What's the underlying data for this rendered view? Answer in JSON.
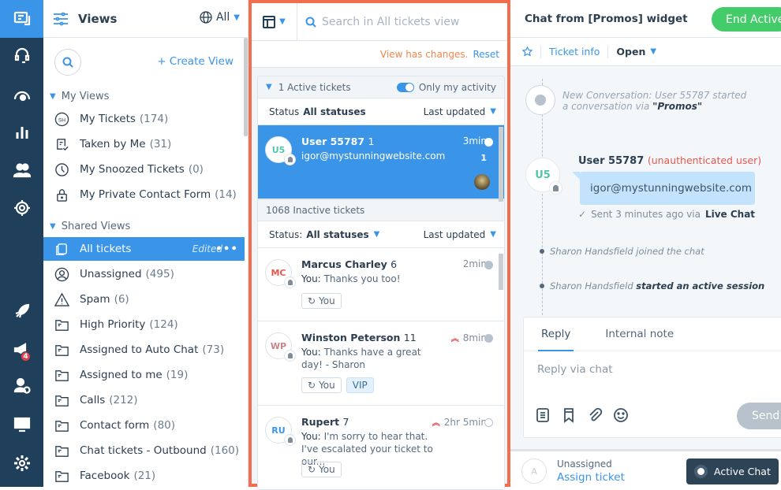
{
  "rail": {
    "items": [
      {
        "icon": "conversations-icon",
        "active": true
      },
      {
        "icon": "headset-icon"
      },
      {
        "icon": "dashboard-gauge-icon"
      },
      {
        "icon": "reports-bar-icon"
      },
      {
        "icon": "contacts-icon"
      },
      {
        "icon": "target-icon"
      },
      {
        "icon": "rocket-icon"
      },
      {
        "icon": "megaphone-icon",
        "badge": "4"
      },
      {
        "icon": "add-user-icon"
      },
      {
        "icon": "monitor-icon"
      },
      {
        "icon": "settings-gear-icon"
      }
    ]
  },
  "views": {
    "title": "Views",
    "filter_label": "All",
    "create_view": "+ Create View",
    "sections": {
      "my_views": "My Views",
      "shared_views": "Shared Views"
    },
    "my_views": [
      {
        "label": "My Tickets",
        "count": "(174)",
        "icon": "initials-sh-icon"
      },
      {
        "label": "Taken by Me",
        "count": "(31)",
        "icon": "ticket-check-icon"
      },
      {
        "label": "My Snoozed Tickets",
        "count": "(0)",
        "icon": "clock-icon"
      },
      {
        "label": "My Private Contact Form",
        "count": "(14)",
        "icon": "lock-icon"
      }
    ],
    "shared_views": [
      {
        "label": "All tickets",
        "count": "",
        "icon": "all-tickets-icon",
        "selected": true,
        "edited": "Edited",
        "more": "•••"
      },
      {
        "label": "Unassigned",
        "count": "(495)",
        "icon": "user-circle-icon"
      },
      {
        "label": "Spam",
        "count": "(6)",
        "icon": "warning-icon"
      },
      {
        "label": "High Priority",
        "count": "(124)",
        "icon": "folder-icon"
      },
      {
        "label": "Assigned to Auto Chat",
        "count": "(73)",
        "icon": "folder-icon"
      },
      {
        "label": "Assigned to me",
        "count": "(19)",
        "icon": "folder-icon"
      },
      {
        "label": "Calls",
        "count": "(212)",
        "icon": "folder-icon"
      },
      {
        "label": "Contact form",
        "count": "(80)",
        "icon": "folder-icon"
      },
      {
        "label": "Chat tickets - Outbound",
        "count": "(160)",
        "icon": "folder-icon"
      },
      {
        "label": "Facebook",
        "count": "(21)",
        "icon": "folder-icon"
      }
    ]
  },
  "list": {
    "search_placeholder": "Search in All tickets view",
    "changes_msg": "View has changes.",
    "reset": "Reset",
    "active_group": {
      "title": "1 Active tickets",
      "toggle_label": "Only my activity",
      "toggle_on": true,
      "status_label": "Status",
      "status_value": "All statuses",
      "sort": "Last updated"
    },
    "inactive_group": {
      "title": "1068 Inactive tickets",
      "status_label": "Status:",
      "status_value": "All statuses",
      "sort": "Last updated"
    },
    "active_tickets": [
      {
        "initials": "U5",
        "name": "User 55787",
        "count": "1",
        "message": "igor@mystunningwebsite.com",
        "time": "3min",
        "unread": "1",
        "color": "#4fc8a8"
      }
    ],
    "tickets": [
      {
        "initials": "MC",
        "name": "Marcus Charley",
        "count": "6",
        "from": "You:",
        "message": "Thanks you too!",
        "time": "2min",
        "priority": false,
        "tags": [
          "You"
        ],
        "color": "#e8574d"
      },
      {
        "initials": "WP",
        "name": "Winston Peterson",
        "count": "11",
        "from": "You:",
        "message": "Thanks have a great day! - Sharon",
        "time": "8min",
        "priority": true,
        "tags": [
          "You",
          "VIP"
        ],
        "color": "#c9848a"
      },
      {
        "initials": "RU",
        "name": "Rupert",
        "count": "7",
        "from": "You:",
        "message": "I'm sorry to hear that. I've escalated your ticket to our...",
        "time": "2hr 5min",
        "priority": true,
        "tags": [
          "You"
        ],
        "color": "#3a95e8"
      }
    ]
  },
  "chat": {
    "title": "Chat from [Promos] widget",
    "end_button": "End Active",
    "ticket_info": "Ticket info",
    "status": "Open",
    "system_msg_prefix": "New Conversation: User 55787 started a conversation via",
    "system_msg_channel": "\"Promos\"",
    "user_initials": "U5",
    "user_name": "User 55787",
    "user_tag": "(unauthenticated user)",
    "message": "igor@mystunningwebsite.com",
    "sent_prefix": "Sent 3 minutes ago via",
    "sent_channel": "Live Chat",
    "events": [
      {
        "actor": "Sharon Handsfield",
        "text": "joined the chat",
        "bold": false
      },
      {
        "actor": "Sharon Handsfield",
        "text": "started an active session",
        "bold": true
      }
    ],
    "reply_tabs": [
      "Reply",
      "Internal note"
    ],
    "reply_placeholder": "Reply via chat",
    "send": "Send",
    "assignee_initial": "A",
    "assignee_status": "Unassigned",
    "assign_link": "Assign ticket",
    "active_chat": "Active Chat"
  },
  "colors": {
    "accent": "#3a95e8",
    "rail": "#1f3f5a",
    "highlight_border": "#f26e4e",
    "end_button": "#44cc6a",
    "warning_text": "#f0864a"
  }
}
